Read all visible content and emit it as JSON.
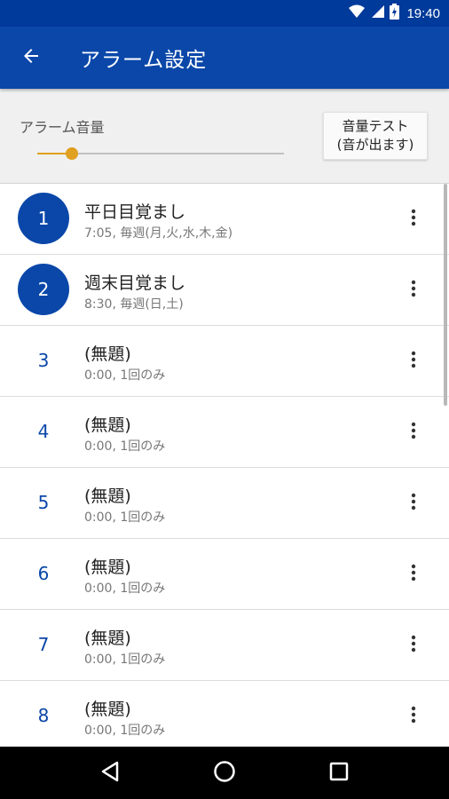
{
  "status_bar": {
    "time": "19:40",
    "icons": [
      "wifi-icon",
      "signal-icon",
      "battery-icon"
    ]
  },
  "app_bar": {
    "title": "アラーム設定",
    "back_icon": "back-arrow-icon"
  },
  "volume": {
    "label": "アラーム音量",
    "level": 0.14,
    "test_button": {
      "line1": "音量テスト",
      "line2": "(音が出ます)"
    }
  },
  "alarms": [
    {
      "number": "1",
      "title": "平日目覚まし",
      "subtitle": "7:05, 毎週(月,火,水,木,金)",
      "enabled": true
    },
    {
      "number": "2",
      "title": "週末目覚まし",
      "subtitle": "8:30, 毎週(日,土)",
      "enabled": true
    },
    {
      "number": "3",
      "title": "(無題)",
      "subtitle": "0:00, 1回のみ",
      "enabled": false
    },
    {
      "number": "4",
      "title": "(無題)",
      "subtitle": "0:00, 1回のみ",
      "enabled": false
    },
    {
      "number": "5",
      "title": "(無題)",
      "subtitle": "0:00, 1回のみ",
      "enabled": false
    },
    {
      "number": "6",
      "title": "(無題)",
      "subtitle": "0:00, 1回のみ",
      "enabled": false
    },
    {
      "number": "7",
      "title": "(無題)",
      "subtitle": "0:00, 1回のみ",
      "enabled": false
    },
    {
      "number": "8",
      "title": "(無題)",
      "subtitle": "0:00, 1回のみ",
      "enabled": false
    }
  ],
  "colors": {
    "primary": "#0a47a9",
    "status_bar": "#003a9a",
    "accent": "#e0a020"
  },
  "nav": {
    "back": "nav-back-icon",
    "home": "nav-home-icon",
    "recents": "nav-recents-icon"
  }
}
